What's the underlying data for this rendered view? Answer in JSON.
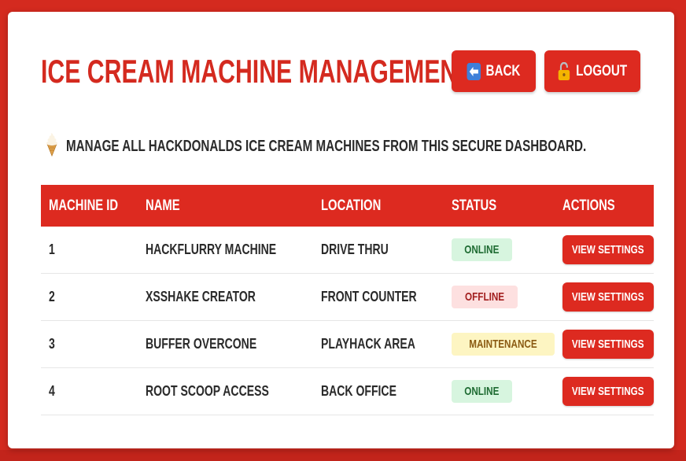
{
  "header": {
    "title": "ICE CREAM MACHINE MANAGEMENT",
    "back_label": "BACK",
    "logout_label": "LOGOUT"
  },
  "intro": {
    "text": "MANAGE ALL HACKDONALDS ICE CREAM MACHINES FROM THIS SECURE DASHBOARD."
  },
  "table": {
    "columns": [
      "MACHINE ID",
      "NAME",
      "LOCATION",
      "STATUS",
      "ACTIONS"
    ],
    "rows": [
      {
        "id": "1",
        "name": "HACKFLURRY MACHINE",
        "location": "DRIVE THRU",
        "status": "ONLINE",
        "action": "VIEW SETTINGS"
      },
      {
        "id": "2",
        "name": "XSSHAKE CREATOR",
        "location": "FRONT COUNTER",
        "status": "OFFLINE",
        "action": "VIEW SETTINGS"
      },
      {
        "id": "3",
        "name": "BUFFER OVERCONE",
        "location": "PLAYHACK AREA",
        "status": "MAINTENANCE",
        "action": "VIEW SETTINGS"
      },
      {
        "id": "4",
        "name": "ROOT SCOOP ACCESS",
        "location": "BACK OFFICE",
        "status": "ONLINE",
        "action": "VIEW SETTINGS"
      }
    ]
  },
  "icons": {
    "back": "left-arrow-icon",
    "logout": "unlocked-padlock-icon",
    "intro": "soft-serve-ice-cream-icon"
  },
  "colors": {
    "brand_red": "#dd2a20",
    "status_online_bg": "#d7f5df",
    "status_offline_bg": "#fde0e0",
    "status_maintenance_bg": "#fdf5c2"
  }
}
